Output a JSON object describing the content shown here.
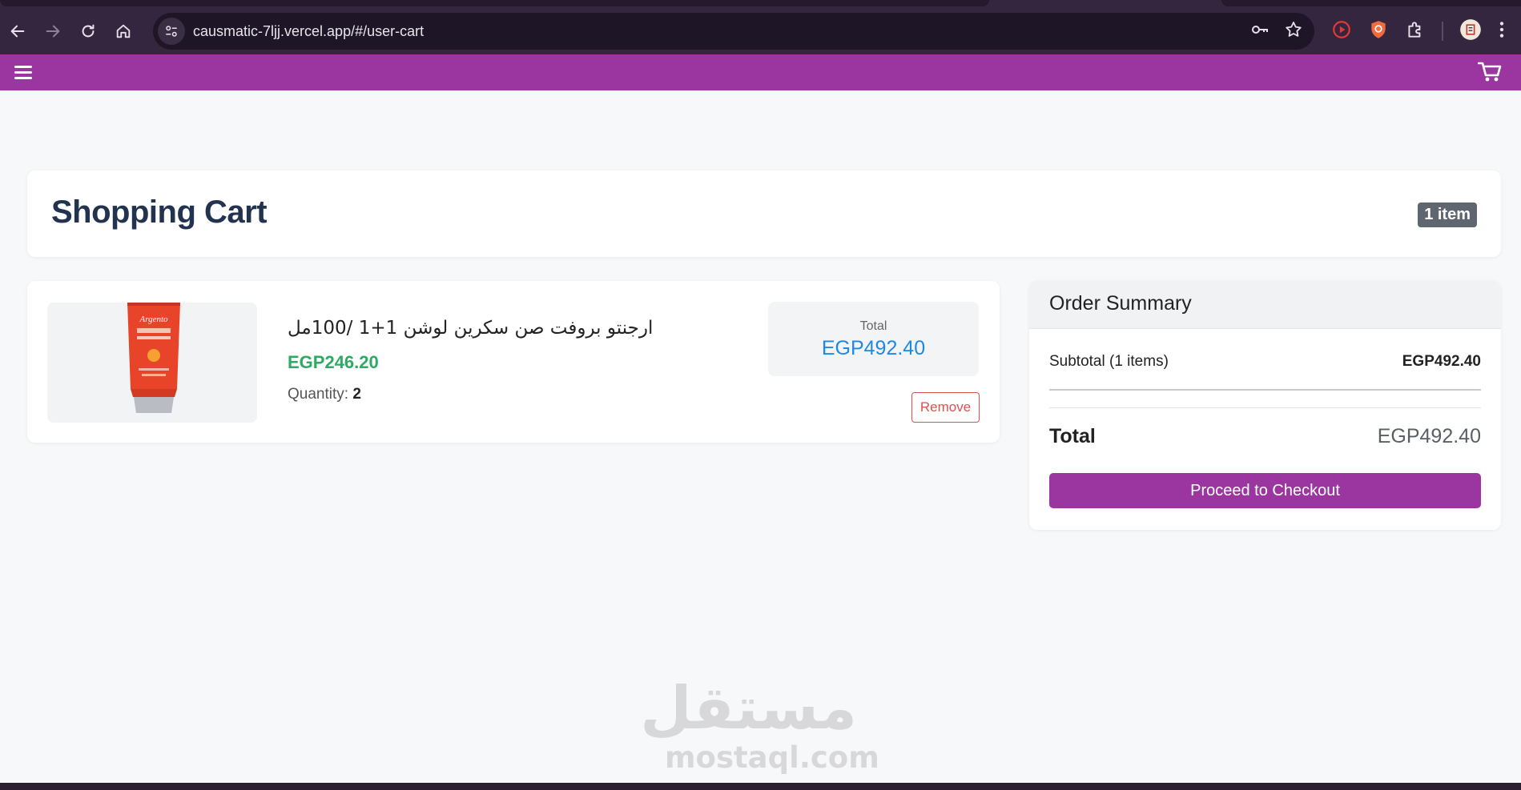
{
  "browser": {
    "url": "causmatic-7ljj.vercel.app/#/user-cart",
    "icons": [
      "back-icon",
      "forward-icon",
      "reload-icon",
      "home-icon",
      "site-info-icon",
      "password-key-icon",
      "bookmark-star-icon",
      "extension-record-icon",
      "extension-shield-icon",
      "extensions-puzzle-icon",
      "profile-avatar-icon",
      "more-menu-icon"
    ]
  },
  "header": {
    "brand_color": "#9b36a1",
    "icons": [
      "hamburger-menu-icon",
      "shopping-cart-icon"
    ]
  },
  "page": {
    "title": "Shopping Cart",
    "item_count": "1 item"
  },
  "cart_item": {
    "name": "ارجنتو بروفت صن سكرين لوشن 1+1 /100مل",
    "price": "EGP246.20",
    "quantity_label": "Quantity:",
    "quantity": "2",
    "total_label": "Total",
    "total": "EGP492.40",
    "remove_label": "Remove",
    "image_text": "Argento"
  },
  "summary": {
    "title": "Order Summary",
    "subtotal_label": "Subtotal (1 items)",
    "subtotal_value": "EGP492.40",
    "total_label": "Total",
    "total_value": "EGP492.40",
    "checkout_label": "Proceed to Checkout"
  },
  "watermark": {
    "arabic": "مستقل",
    "latin": "mostaql.com"
  }
}
